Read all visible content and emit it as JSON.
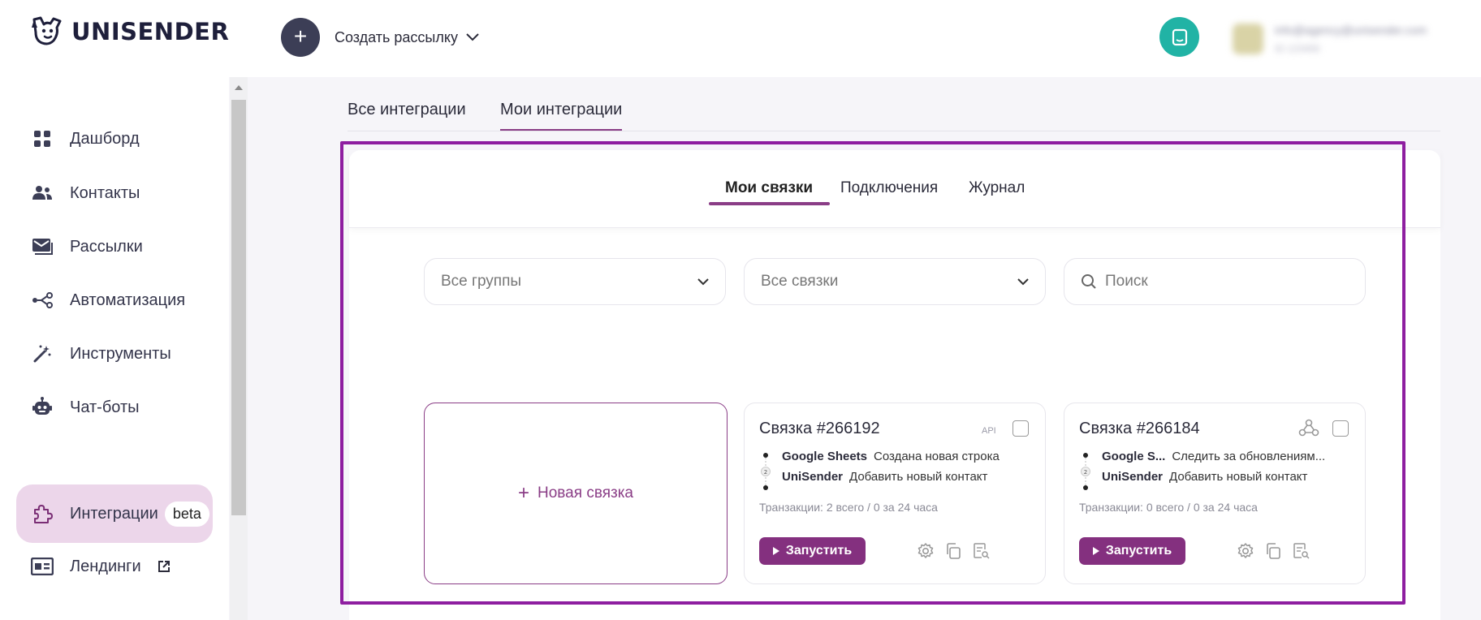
{
  "header": {
    "logo_text": "UNISENDER",
    "create_label": "Создать рассылку",
    "user_email": "info@agency@unisender.com",
    "user_sub": "ID 123456"
  },
  "sidebar": {
    "items": [
      {
        "label": "Дашборд",
        "icon": "dashboard-icon"
      },
      {
        "label": "Контакты",
        "icon": "contacts-icon"
      },
      {
        "label": "Рассылки",
        "icon": "mail-icon"
      },
      {
        "label": "Автоматизация",
        "icon": "automation-icon"
      },
      {
        "label": "Инструменты",
        "icon": "magic-wand-icon"
      },
      {
        "label": "Чат-боты",
        "icon": "robot-icon"
      },
      {
        "label": "Интеграции",
        "icon": "puzzle-icon",
        "badge": "beta",
        "active": true
      },
      {
        "label": "Лендинги",
        "icon": "landing-icon",
        "external": true
      }
    ]
  },
  "main": {
    "tabs": [
      "Все интеграции",
      "Мои интеграции"
    ],
    "active_tab": "Мои интеграции",
    "subtabs": [
      "Мои связки",
      "Подключения",
      "Журнал"
    ],
    "active_subtab": "Мои связки",
    "filters": {
      "groups": "Все группы",
      "links": "Все связки",
      "search_placeholder": "Поиск"
    },
    "new_link_label": "Новая связка",
    "cards": [
      {
        "title": "Связка #266192",
        "type_label": "API",
        "source_app": "Google Sheets",
        "source_event": "Создана новая строка",
        "step_number": "2",
        "target_app": "UniSender",
        "target_action": "Добавить новый контакт",
        "transactions": "Транзакции: 2 всего / 0 за 24 часа",
        "run_label": "Запустить"
      },
      {
        "title": "Связка #266184",
        "type_icon": "webhook-icon",
        "source_app": "Google S...",
        "source_event": "Следить за обновлениям...",
        "step_number": "2",
        "target_app": "UniSender",
        "target_action": "Добавить новый контакт",
        "transactions": "Транзакции: 0 всего / 0 за 24 часа",
        "run_label": "Запустить"
      }
    ]
  },
  "colors": {
    "accent": "#84307f",
    "highlight": "#8e1ea0",
    "teal": "#21b3a5",
    "dark": "#3c3e56",
    "active_nav_bg": "#ecd6ea"
  }
}
